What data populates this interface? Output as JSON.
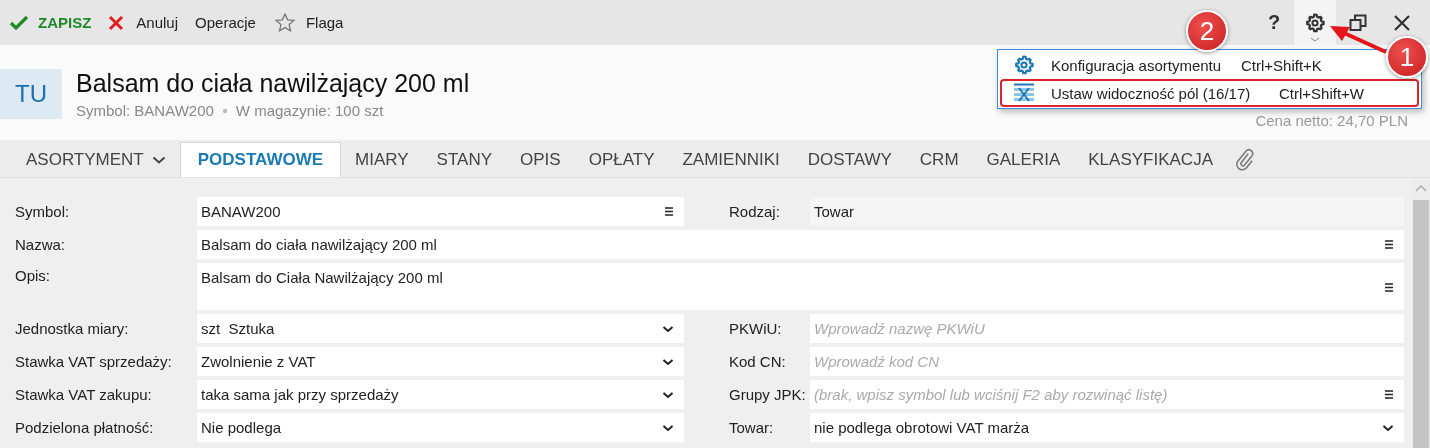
{
  "toolbar": {
    "actions": [
      {
        "kind": "save",
        "label": "ZAPISZ"
      },
      {
        "kind": "cancel",
        "label": "Anuluj"
      },
      {
        "kind": "plain",
        "label": "Operacje"
      },
      {
        "kind": "flag",
        "label": "Flaga"
      }
    ],
    "help": "?",
    "settings_expanded": true
  },
  "header": {
    "badge": "TU",
    "title": "Balsam do ciała nawilżający 200 ml",
    "symbol": "Symbol: BANAW200",
    "stock": "W magazynie: 100 szt",
    "price": "Cena netto: 24,70 PLN"
  },
  "tabs": [
    {
      "kind": "menu",
      "label": "ASORTYMENT",
      "selected": false
    },
    {
      "kind": "tab",
      "label": "PODSTAWOWE",
      "selected": true
    },
    {
      "kind": "tab",
      "label": "MIARY",
      "selected": false
    },
    {
      "kind": "tab",
      "label": "STANY",
      "selected": false
    },
    {
      "kind": "tab",
      "label": "OPIS",
      "selected": false
    },
    {
      "kind": "tab",
      "label": "OPŁATY",
      "selected": false
    },
    {
      "kind": "tab",
      "label": "ZAMIENNIKI",
      "selected": false
    },
    {
      "kind": "tab",
      "label": "DOSTAWY",
      "selected": false
    },
    {
      "kind": "tab",
      "label": "CRM",
      "selected": false
    },
    {
      "kind": "tab",
      "label": "GALERIA",
      "selected": false
    },
    {
      "kind": "tab",
      "label": "KLASYFIKACJA",
      "selected": false
    },
    {
      "kind": "attachment",
      "selected": false
    }
  ],
  "form": {
    "rows": [
      [
        {
          "label": "Symbol:",
          "kind": "list",
          "value": "BANAW200"
        },
        {
          "label": "Rodzaj:",
          "kind": "readonly",
          "value": "Towar"
        }
      ],
      [
        {
          "label": "Nazwa:",
          "kind": "list",
          "value": "Balsam do ciała nawilżający 200 ml"
        }
      ],
      [
        {
          "label": "Opis:",
          "kind": "multiline",
          "value": "Balsam do Ciała Nawilżający 200 ml"
        }
      ],
      [
        {
          "label": "Jednostka miary:",
          "kind": "select",
          "value": "szt  Sztuka"
        },
        {
          "label": "PKWiU:",
          "kind": "text",
          "placeholder": "Wprowadź nazwę PKWiU"
        }
      ],
      [
        {
          "label": "Stawka VAT sprzedaży:",
          "kind": "select",
          "value": "Zwolnienie z VAT"
        },
        {
          "label": "Kod CN:",
          "kind": "text",
          "placeholder": "Wprowadź kod CN"
        }
      ],
      [
        {
          "label": "Stawka VAT zakupu:",
          "kind": "select",
          "value": "taka sama jak przy sprzedaży"
        },
        {
          "label": "Grupy JPK:",
          "kind": "list",
          "placeholder": "(brak, wpisz symbol lub wciśnij F2 aby rozwinąć listę)"
        }
      ],
      [
        {
          "label": "Podzielona płatność:",
          "kind": "select",
          "value": "Nie podlega"
        },
        {
          "label": "Towar:",
          "kind": "select",
          "value": "nie podlega obrotowi VAT marża"
        }
      ]
    ]
  },
  "menu": {
    "items": [
      {
        "kind": "gear",
        "label": "Konfiguracja asortymentu",
        "shortcut": "Ctrl+Shift+K",
        "highlighted": false
      },
      {
        "kind": "fields",
        "label": "Ustaw widoczność pól (16/17)",
        "shortcut": "Ctrl+Shift+W",
        "highlighted": true
      }
    ]
  },
  "annotations": [
    {
      "kind": "arrow-callout",
      "label": "1"
    },
    {
      "kind": "callout",
      "label": "2"
    }
  ]
}
